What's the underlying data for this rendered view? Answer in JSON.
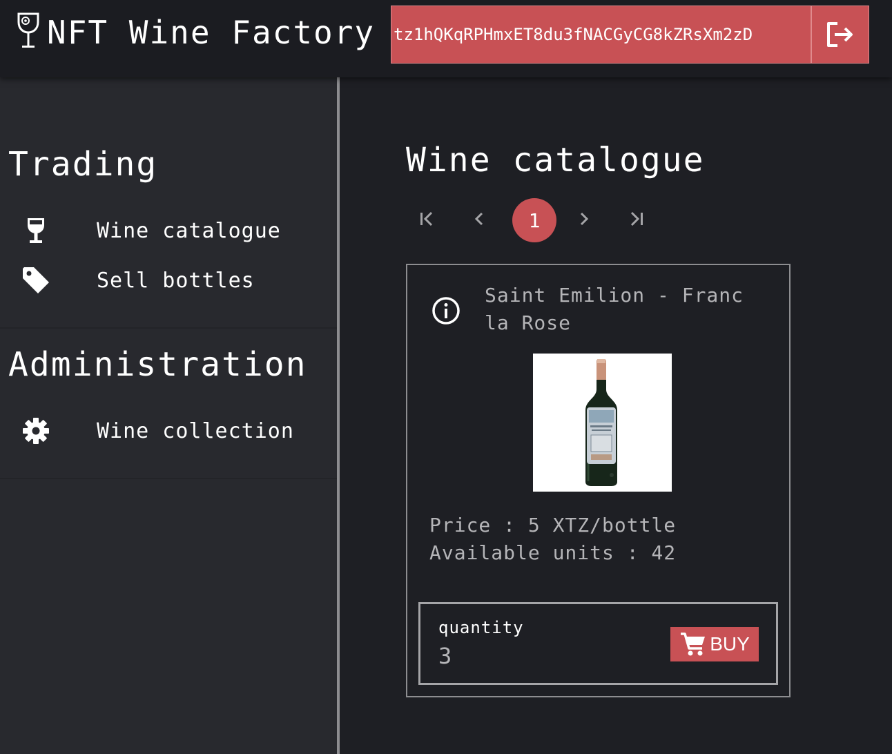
{
  "header": {
    "app_title": "NFT Wine Factory",
    "account_address": "tz1hQKqRPHmxET8du3fNACGyCG8kZRsXm2zD",
    "logout_icon": "logout-icon",
    "accent_color": "#c85155"
  },
  "sidebar": {
    "sections": [
      {
        "heading": "Trading",
        "items": [
          {
            "label": "Wine catalogue",
            "icon": "wine-glass-icon"
          },
          {
            "label": "Sell bottles",
            "icon": "tag-icon"
          }
        ]
      },
      {
        "heading": "Administration",
        "items": [
          {
            "label": "Wine collection",
            "icon": "gear-icon"
          }
        ]
      }
    ]
  },
  "main": {
    "title": "Wine catalogue",
    "pagination": {
      "current_page": "1",
      "icons": [
        "first-page-icon",
        "previous-page-icon",
        "next-page-icon",
        "last-page-icon"
      ]
    },
    "wine": {
      "name": "Saint Emilion - Franc la Rose",
      "price_text": "Price : 5 XTZ/bottle",
      "units_text": "Available units : 42",
      "quantity_label": "quantity",
      "quantity_value": "3",
      "buy_label": "BUY"
    }
  }
}
